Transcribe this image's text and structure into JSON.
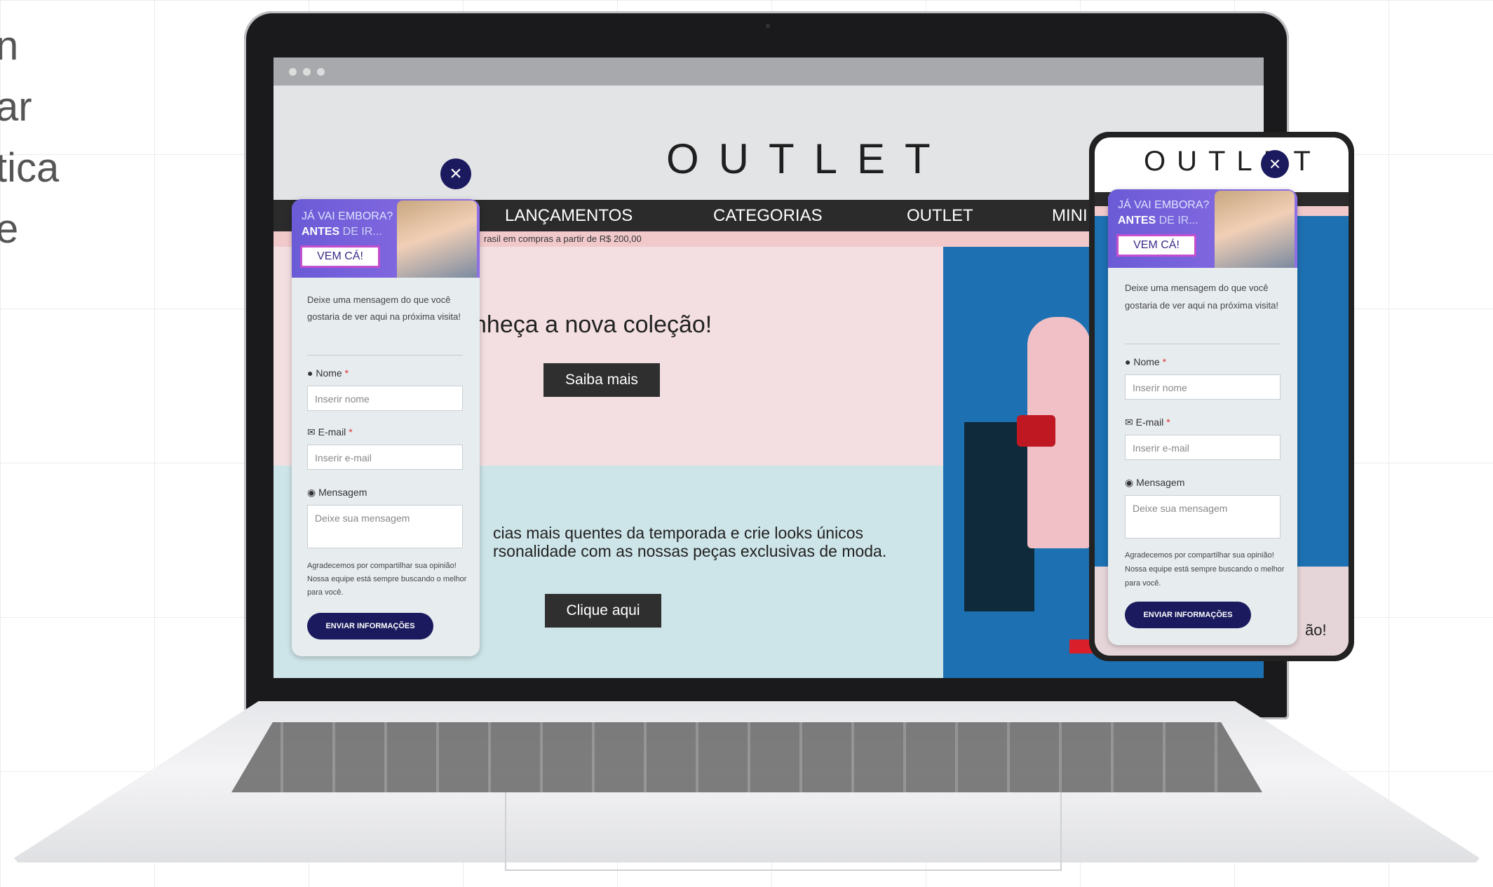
{
  "side_text": {
    "lines": [
      "n",
      "ar",
      "tica",
      "e"
    ]
  },
  "site": {
    "logo": "OUTLET",
    "nav": [
      "LANÇAMENTOS",
      "CATEGORIAS",
      "OUTLET",
      "MINI"
    ],
    "promo": "rasil em compras a partir de R$ 200,00",
    "headline": "nheça a nova coleção!",
    "cta1": "Saiba mais",
    "body_line1": "cias mais quentes da temporada e crie looks únicos",
    "body_line2": "rsonalidade com as nossas peças exclusivas de moda.",
    "cta2": "Clique aqui",
    "phone_tail": "ão!"
  },
  "popup": {
    "banner_line1": "JÁ VAI EMBORA?",
    "banner_bold": "ANTES",
    "banner_rest": " DE IR...",
    "vem_ca": "VEM CÁ!",
    "intro": "Deixe uma mensagem do que você gostaria de ver aqui na próxima visita!",
    "name_label": "Nome",
    "name_placeholder": "Inserir nome",
    "email_label": "E-mail",
    "email_placeholder": "Inserir e-mail",
    "message_label": "Mensagem",
    "message_placeholder": "Deixe sua mensagem",
    "thanks": "Agradecemos por compartilhar sua opinião! Nossa equipe está sempre buscando o melhor para você.",
    "send": "ENVIAR INFORMAÇÕES",
    "required_mark": "*",
    "close": "×"
  },
  "icons": {
    "user": "user-icon",
    "mail": "mail-icon",
    "chat": "chat-icon"
  },
  "colors": {
    "navy": "#1b1a5e",
    "purple": "#7c63de",
    "accent": "#c44fcf"
  }
}
